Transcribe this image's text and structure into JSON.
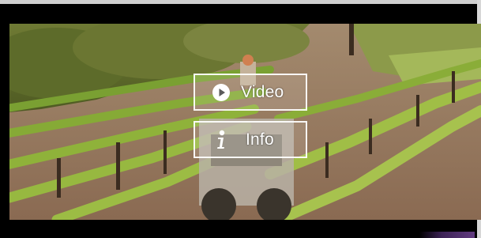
{
  "overlay": {
    "video_label": "Video",
    "info_label": "Info"
  },
  "icons": {
    "video": "play-circle-icon",
    "info": "info-icon"
  },
  "colors": {
    "background": "#000000",
    "button_border": "#ffffff",
    "foliage": "#6f8a2e",
    "soil": "#9a7a5c"
  }
}
